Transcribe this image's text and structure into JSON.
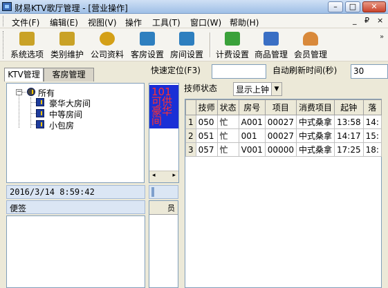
{
  "window": {
    "title": "财易KTV歌厅管理 - [营业操作]",
    "min": "–",
    "max": "□",
    "close": "✕"
  },
  "menu": {
    "items": [
      "文件(F)",
      "编辑(E)",
      "视图(V)",
      "操作",
      "工具(T)",
      "窗口(W)",
      "帮助(H)"
    ],
    "mdi": {
      "minimize": "_",
      "restore": "₽",
      "close": "×"
    }
  },
  "toolbar": {
    "buttons": [
      {
        "label": "系统选项",
        "icon": "key-icon",
        "color": "#c9a227"
      },
      {
        "label": "类别维护",
        "icon": "key-icon",
        "color": "#c9a227"
      },
      {
        "label": "公司资料",
        "icon": "coins-icon",
        "color": "#d4a017"
      },
      {
        "label": "客房设置",
        "icon": "calculator-icon",
        "color": "#2e7fbf"
      },
      {
        "label": "房间设置",
        "icon": "calculator-icon",
        "color": "#2e7fbf"
      },
      {
        "label": "计费设置",
        "icon": "money-icon",
        "color": "#3aa13a"
      },
      {
        "label": "商品管理",
        "icon": "box-icon",
        "color": "#3a6fc4"
      },
      {
        "label": "会员管理",
        "icon": "person-icon",
        "color": "#d9893a"
      }
    ],
    "overflow": "»"
  },
  "tabs": [
    "KTV管理",
    "客房管理"
  ],
  "quick": {
    "locate_label": "快速定位(F3)",
    "locate_value": "",
    "refresh_label": "自动刷新时间(秒)",
    "refresh_value": "30"
  },
  "tree": {
    "root": "所有",
    "children": [
      "豪华大房间",
      "中等房间",
      "小包房"
    ]
  },
  "room_tile": {
    "lines": [
      "101",
      "可供",
      "豪华",
      "间"
    ]
  },
  "technician": {
    "status_label": "技师状态",
    "filter_value": "显示上钟",
    "columns": [
      "技师",
      "状态",
      "房号",
      "项目",
      "消费项目",
      "起钟",
      "落"
    ],
    "rows": [
      [
        "1",
        "050",
        "忙",
        "A001",
        "00027",
        "中式桑拿",
        "13:58",
        "14:"
      ],
      [
        "2",
        "051",
        "忙",
        "001",
        "00027",
        "中式桑拿",
        "14:17",
        "15:"
      ],
      [
        "3",
        "057",
        "忙",
        "V001",
        "00000",
        "中式桑拿",
        "17:25",
        "18:"
      ]
    ]
  },
  "datetime": "2016/3/14 8:59:42",
  "note_label": "便签",
  "mini_header": "员"
}
